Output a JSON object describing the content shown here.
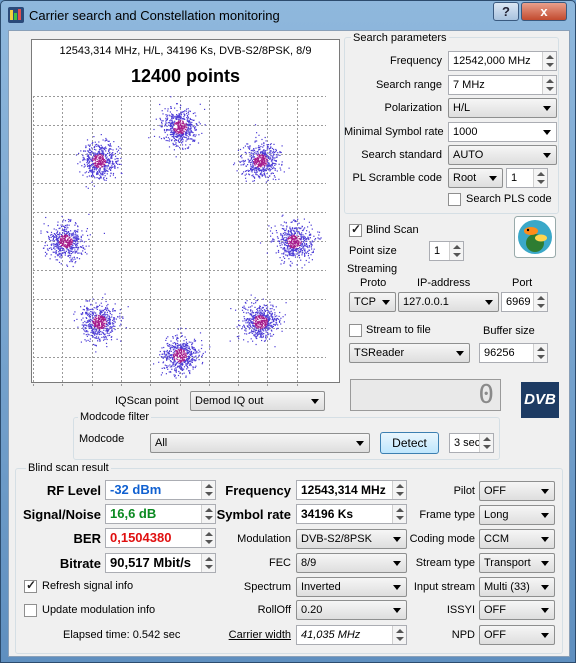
{
  "window": {
    "title": "Carrier search and Constellation monitoring",
    "help_label": "?",
    "close_label": "x"
  },
  "constellation": {
    "info": "12543,314 MHz, H/L, 34196 Ks, DVB-S2/8PSK, 8/9",
    "points_label": "12400 points",
    "chart_data": {
      "type": "scatter",
      "title": "12400 points",
      "clusters": [
        {
          "x": 0.0,
          "y": 0.78
        },
        {
          "x": 0.55,
          "y": 0.55
        },
        {
          "x": 0.78,
          "y": 0.0
        },
        {
          "x": 0.55,
          "y": -0.55
        },
        {
          "x": 0.0,
          "y": -0.78
        },
        {
          "x": -0.55,
          "y": -0.55
        },
        {
          "x": -0.78,
          "y": 0.0
        },
        {
          "x": -0.55,
          "y": 0.55
        }
      ],
      "total_points": 12400,
      "grid": true,
      "point_color": "#4b3bd6",
      "center_color": "#a61a8a"
    }
  },
  "search": {
    "group_title": "Search parameters",
    "frequency_label": "Frequency",
    "frequency_value": "12542,000 MHz",
    "range_label": "Search range",
    "range_value": "7 MHz",
    "polarization_label": "Polarization",
    "polarization_value": "H/L",
    "minsr_label": "Minimal Symbol rate",
    "minsr_value": "1000",
    "standard_label": "Search standard",
    "standard_value": "AUTO",
    "plscramble_label": "PL Scramble code",
    "plscramble_mode": "Root",
    "plscramble_value": "1",
    "searchpls_label": "Search PLS code"
  },
  "blindscan": {
    "label": "Blind Scan",
    "pointsize_label": "Point size",
    "pointsize_value": "1"
  },
  "streaming": {
    "title": "Streaming",
    "proto_label": "Proto",
    "proto_value": "TCP",
    "ip_label": "IP-address",
    "ip_value": "127.0.0.1",
    "port_label": "Port",
    "port_value": "6969",
    "streamfile_label": "Stream to file",
    "buffer_label": "Buffer size",
    "buffer_value": "96256",
    "reader_value": "TSReader"
  },
  "lcd_value": "0",
  "logo_text": "DVB",
  "iq": {
    "label": "IQScan point",
    "value": "Demod IQ out"
  },
  "modcode": {
    "group_title": "Modcode filter",
    "label": "Modcode",
    "value": "All",
    "detect_label": "Detect",
    "interval_value": "3 sec"
  },
  "result": {
    "group_title": "Blind scan result",
    "rf_label": "RF Level",
    "rf_value": "-32 dBm",
    "sn_label": "Signal/Noise",
    "sn_value": "16,6 dB",
    "ber_label": "BER",
    "ber_value": "0,1504380",
    "bitrate_label": "Bitrate",
    "bitrate_value": "90,517 Mbit/s",
    "refresh_label": "Refresh signal info",
    "update_label": "Update modulation info",
    "elapsed_label": "Elapsed time: 0.542 sec",
    "freq_label": "Frequency",
    "freq_value": "12543,314 MHz",
    "sr_label": "Symbol rate",
    "sr_value": "34196 Ks",
    "mod_label": "Modulation",
    "mod_value": "DVB-S2/8PSK",
    "fec_label": "FEC",
    "fec_value": "8/9",
    "spectrum_label": "Spectrum",
    "spectrum_value": "Inverted",
    "rolloff_label": "RollOff",
    "rolloff_value": "0.20",
    "cw_label": "Carrier width",
    "cw_value": "41,035 MHz",
    "pilot_label": "Pilot",
    "pilot_value": "OFF",
    "frametype_label": "Frame type",
    "frametype_value": "Long",
    "coding_label": "Coding mode",
    "coding_value": "CCM",
    "streamtype_label": "Stream type",
    "streamtype_value": "Transport",
    "input_label": "Input stream",
    "input_value": "Multi (33)",
    "issyi_label": "ISSYI",
    "issyi_value": "OFF",
    "npd_label": "NPD",
    "npd_value": "OFF"
  },
  "colors": {
    "rf": "#1060d0",
    "sn": "#0a8a20",
    "ber": "#e01010"
  }
}
